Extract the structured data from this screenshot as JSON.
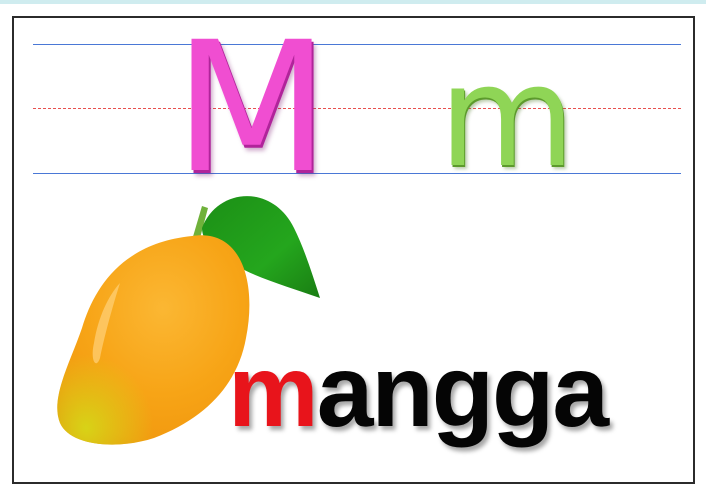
{
  "card": {
    "uppercase_letter": "M",
    "lowercase_letter": "m",
    "word_first_letter": "m",
    "word_rest": "angga",
    "picture": "mango-illustration"
  },
  "colors": {
    "uppercase_letter": "#f04ed1",
    "lowercase_letter": "#8fd556",
    "word_first_letter": "#e8141b",
    "word_rest": "#050505",
    "guide_solid": "#4a78d6",
    "guide_dashed": "#e8504f",
    "mango_body": "#f7a416",
    "mango_tip": "#d8d317",
    "leaf": "#1f9a1a"
  }
}
